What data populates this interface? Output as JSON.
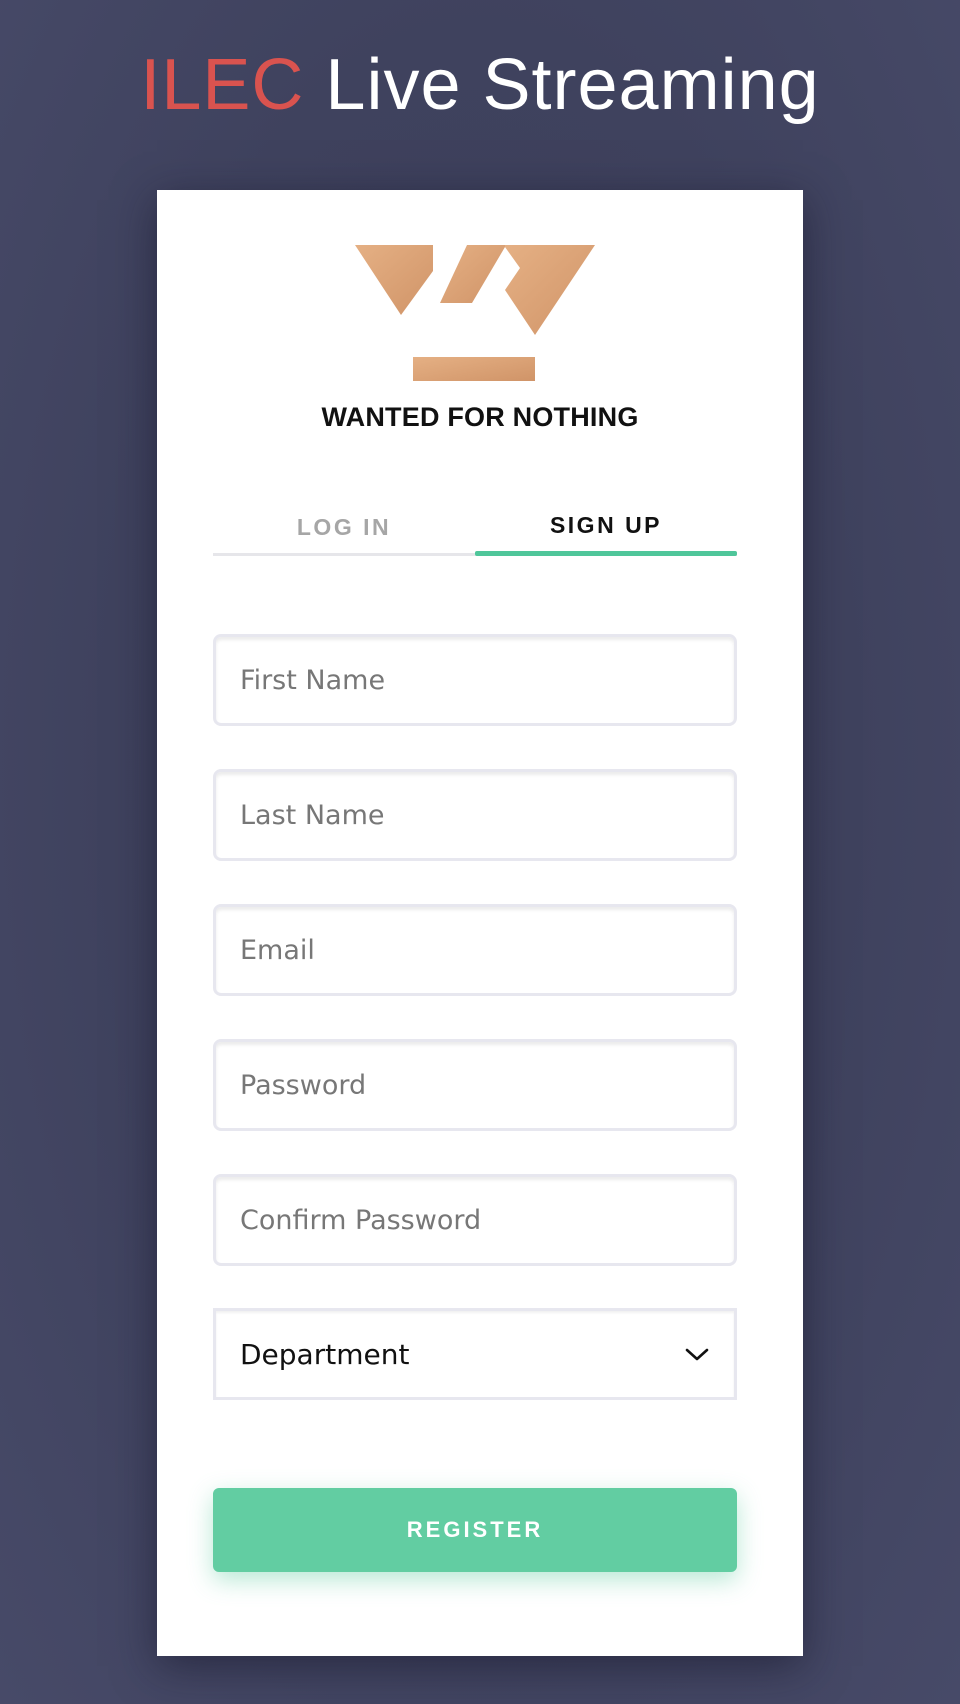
{
  "header": {
    "brand_part1": "ILEC",
    "brand_part2": "Live Streaming"
  },
  "card": {
    "logo_icon": "wanted-for-nothing-w-crown-logo",
    "org_name": "WANTED FOR NOTHING",
    "tabs": [
      {
        "label": "LOG IN",
        "active": false
      },
      {
        "label": "SIGN UP",
        "active": true
      }
    ],
    "fields": {
      "first_name": {
        "value": "",
        "placeholder": "First Name"
      },
      "last_name": {
        "value": "",
        "placeholder": "Last Name"
      },
      "email": {
        "value": "",
        "placeholder": "Email"
      },
      "password": {
        "value": "",
        "placeholder": "Password"
      },
      "confirm_password": {
        "value": "",
        "placeholder": "Confirm Password"
      }
    },
    "department": {
      "selected": "Department",
      "icon": "chevron-down-icon"
    },
    "register_label": "REGISTER"
  },
  "colors": {
    "background": "#3f425e",
    "brand_accent": "#d9534f",
    "primary_green": "#62cda2",
    "tab_underline": "#4fc69a",
    "logo_gold": "#d9a27a"
  }
}
